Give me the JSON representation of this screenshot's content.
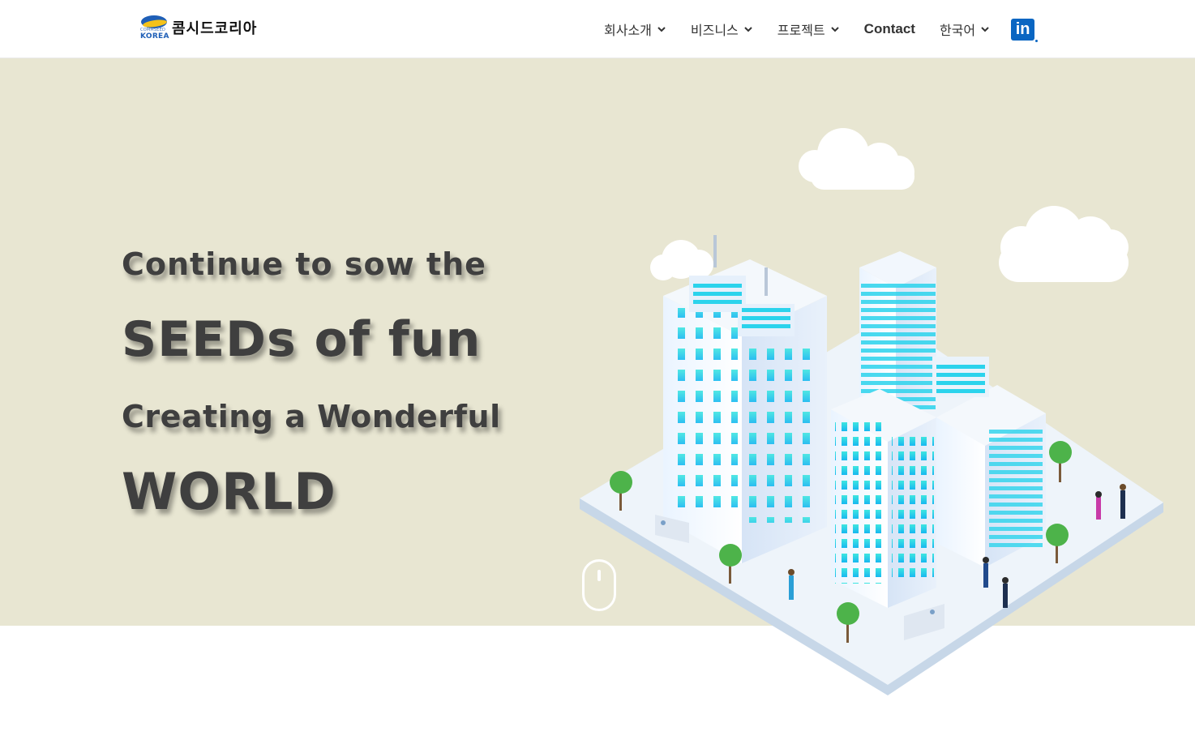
{
  "header": {
    "logo": {
      "company_name": "콤시드코리아",
      "mark_small_text": "COMMSEED",
      "mark_text": "KOREA"
    },
    "nav": [
      {
        "label": "회사소개",
        "has_dropdown": true
      },
      {
        "label": "비즈니스",
        "has_dropdown": true
      },
      {
        "label": "프로젝트",
        "has_dropdown": true
      },
      {
        "label": "Contact",
        "has_dropdown": false
      },
      {
        "label": "한국어",
        "has_dropdown": true
      }
    ],
    "social": {
      "linkedin_label": "in",
      "icon": "linkedin-icon"
    }
  },
  "hero": {
    "line1": "Continue to sow the",
    "line2": "SEEDs of fun",
    "line3": "Creating a Wonderful",
    "line4": "WORLD",
    "scroll_icon": "mouse-scroll-icon",
    "background_color": "#e8e6d2",
    "illustration": "isometric-city-illustration"
  }
}
